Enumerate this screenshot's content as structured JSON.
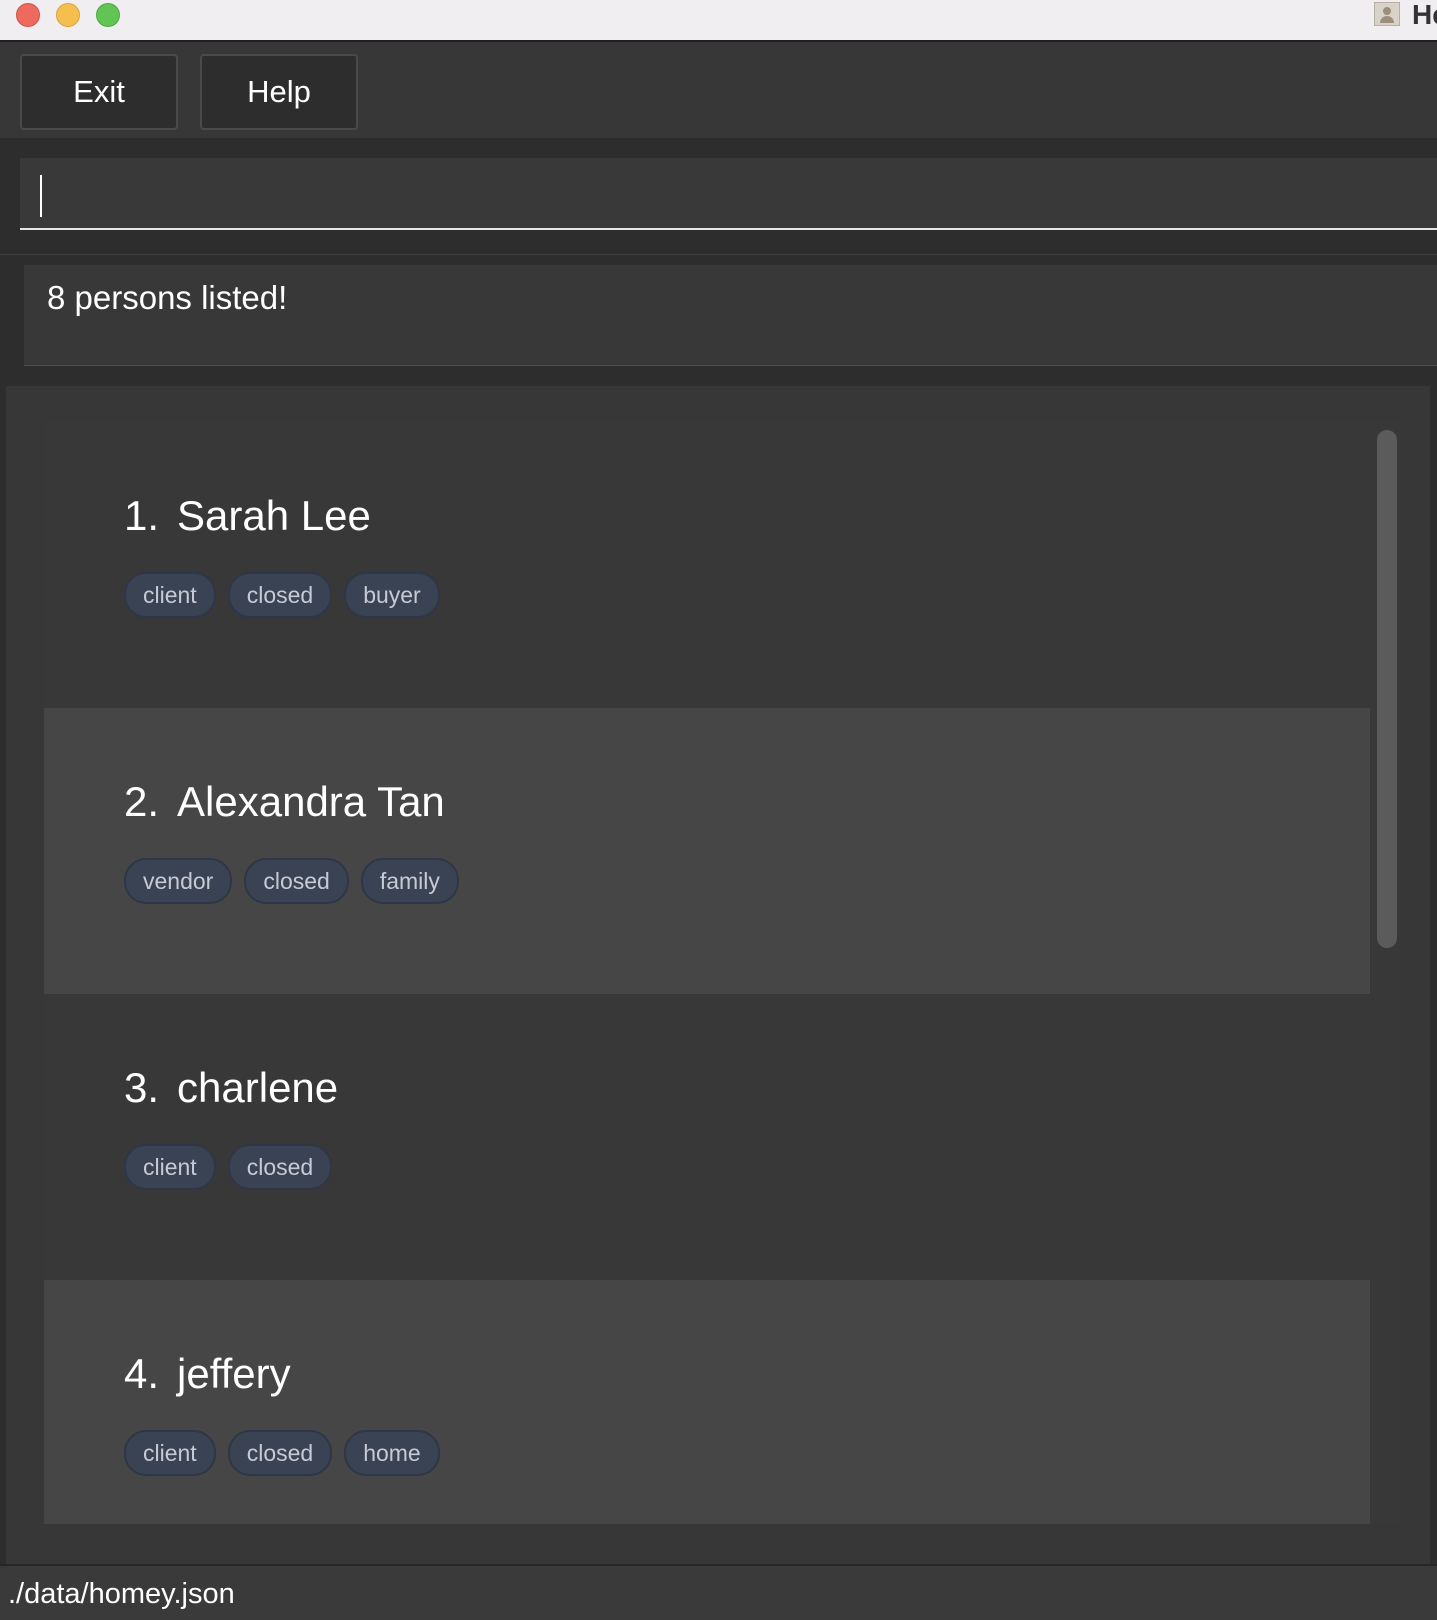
{
  "titlebar": {
    "title": "He",
    "app_icon": "contacts-icon"
  },
  "menu": {
    "exit_label": "Exit",
    "help_label": "Help"
  },
  "command": {
    "value": ""
  },
  "result": {
    "message": "8 persons listed!"
  },
  "persons": [
    {
      "index": "1.",
      "name": "Sarah Lee",
      "tags": [
        "client",
        "closed",
        "buyer"
      ]
    },
    {
      "index": "2.",
      "name": "Alexandra Tan",
      "tags": [
        "vendor",
        "closed",
        "family"
      ]
    },
    {
      "index": "3.",
      "name": "charlene",
      "tags": [
        "client",
        "closed"
      ]
    },
    {
      "index": "4.",
      "name": "jeffery",
      "tags": [
        "client",
        "closed",
        "home"
      ]
    }
  ],
  "status": {
    "file_path": "./data/homey.json"
  },
  "colors": {
    "background": "#2d2d2d",
    "card_odd": "#383838",
    "card_even": "#464646",
    "tag_background": "#3a4354",
    "text": "#ffffff"
  }
}
